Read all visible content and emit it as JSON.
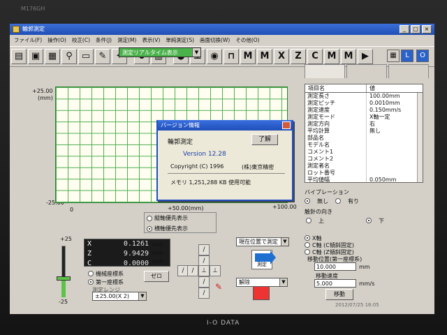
{
  "monitor": {
    "model_label": "M176GH",
    "brand": "I-O DATA"
  },
  "window": {
    "title": "輪郭測定"
  },
  "menu": [
    "ファイル(F)",
    "操作(O)",
    "校正(C)",
    "条件(J)",
    "測定(M)",
    "表示(V)",
    "単純測定(S)",
    "画面切換(W)",
    "その他(O)"
  ],
  "toolbar": {
    "buttons": [
      "open-icon",
      "save-icon",
      "print-icon",
      "probe-icon",
      "monitor-icon",
      "tool-icon",
      "calc-icon",
      "zero-icon",
      "magnify-icon",
      "stylus-icon",
      "globe-icon",
      "sphere-icon",
      "x-icon",
      "z-icon",
      "c-icon",
      "record-icon",
      "play-icon"
    ],
    "right_buttons": [
      "layout-icon",
      "color-icon",
      "l-icon",
      "o-icon"
    ]
  },
  "realtime": {
    "label": "測定リアルタイム表示"
  },
  "graph": {
    "y_top": "+25.00",
    "y_unit": "(mm)",
    "y_bottom": "-25.00",
    "x_left": "0",
    "x_mid": "+50.00(mm)",
    "x_right": "+100.00"
  },
  "orientation": {
    "options": [
      "縦軸優先表示",
      "横軸優先表示"
    ],
    "selected": 1
  },
  "props": {
    "headers": [
      "項目名",
      "値"
    ],
    "rows": [
      [
        "測定長さ",
        "100.00mm"
      ],
      [
        "測定ピッチ",
        "0.0010mm"
      ],
      [
        "測定速度",
        "0.150mm/s"
      ],
      [
        "測定モード",
        "X軸一定"
      ],
      [
        "測定方向",
        "右"
      ],
      [
        "平均計算",
        "無し"
      ],
      [
        "部品名",
        ""
      ],
      [
        "モデル名",
        ""
      ],
      [
        "コメント1",
        ""
      ],
      [
        "コメント2",
        ""
      ],
      [
        "測定者名",
        ""
      ],
      [
        "ロット番号",
        ""
      ],
      [
        "平均値幅",
        "0.050mm"
      ]
    ]
  },
  "vibration": {
    "label": "バイブレーション",
    "none": "無し",
    "yes": "有り",
    "tip_label": "触針の向き",
    "up": "上",
    "down": "下"
  },
  "zscale": {
    "top": "+25",
    "bottom": "-25"
  },
  "coords": [
    {
      "axis": "X",
      "value": "0.1261",
      "unit": "mm"
    },
    {
      "axis": "Z",
      "value": "9.9429",
      "unit": "mm"
    },
    {
      "axis": "C",
      "value": "0.0000",
      "unit": "mm"
    }
  ],
  "coord_system": {
    "machine": "機械座標系",
    "first": "第一座標系",
    "range_label": "測定レンジ",
    "range_value": "±25.00(X 2)",
    "zero_button": "ゼロ"
  },
  "measure": {
    "position_select": "現在位置で測定",
    "measure_label": "測定",
    "release_select": "解除"
  },
  "axis_select": {
    "x": "X軸",
    "c": "C軸 (C傾斜固定)",
    "cz": "C軸 (Z傾斜固定)",
    "move_label": "移動位置(第一座標系)",
    "move_value": "10.000",
    "move_unit": "mm",
    "speed_label": "移動速度",
    "speed_value": "5.000",
    "speed_unit": "mm/s",
    "move_button": "移動"
  },
  "dialog": {
    "title": "バージョン情報",
    "app": "輪郭測定",
    "ok": "了解",
    "version": "Version 12.28",
    "copyright": "Copyright (C) 1996",
    "company": "(株)東京精密",
    "memory": "メモリ 1,251,288 KB 使用可能"
  },
  "status": {
    "date": "2012/07/25   16:05"
  }
}
